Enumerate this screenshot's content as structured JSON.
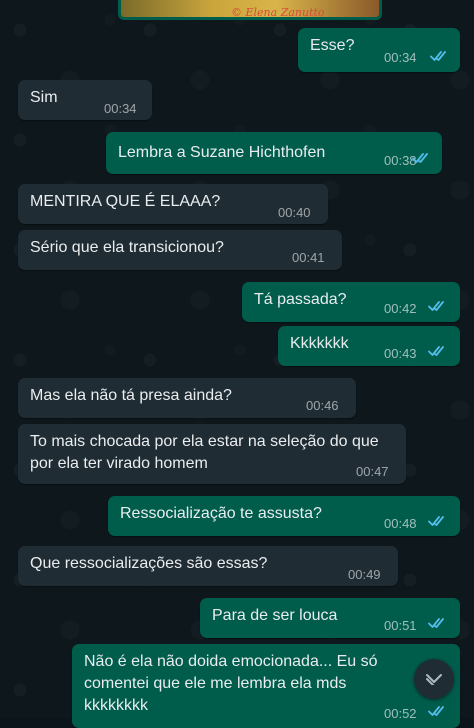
{
  "shared_image": {
    "caption": "© Elena Zanutto"
  },
  "messages": [
    {
      "dir": "out",
      "text": "Esse?",
      "time": "00:34",
      "read": true
    },
    {
      "dir": "in",
      "text": "Sim",
      "time": "00:34"
    },
    {
      "dir": "out",
      "text": "Lembra a Suzane Hichthofen",
      "time": "00:38",
      "read": true
    },
    {
      "dir": "in",
      "text": "MENTIRA QUE É ELAAA?",
      "time": "00:40"
    },
    {
      "dir": "in",
      "text": "Sério que ela transicionou?",
      "time": "00:41"
    },
    {
      "dir": "out",
      "text": "Tá passada?",
      "time": "00:42",
      "read": true
    },
    {
      "dir": "out",
      "text": "Kkkkkkk",
      "time": "00:43",
      "read": true
    },
    {
      "dir": "in",
      "text": "Mas ela não tá presa ainda?",
      "time": "00:46"
    },
    {
      "dir": "in",
      "text": "To mais chocada por ela estar na seleção do que por ela ter virado homem",
      "time": "00:47"
    },
    {
      "dir": "out",
      "text": "Ressocialização te assusta?",
      "time": "00:48",
      "read": true
    },
    {
      "dir": "in",
      "text": "Que ressocializações são essas?",
      "time": "00:49"
    },
    {
      "dir": "out",
      "text": "Para de ser louca",
      "time": "00:51",
      "read": true
    },
    {
      "dir": "out",
      "text": "Não é ela não doida emocionada... Eu só comentei que ele me lembra ela mds kkkkkkkk",
      "time": "00:52",
      "read": true
    }
  ],
  "colors": {
    "background": "#0b141a",
    "incoming_bubble": "#202c33",
    "outgoing_bubble": "#005c4b",
    "read_ticks": "#53bdeb"
  },
  "icons": {
    "scroll_down": "chevron-down-icon",
    "read_receipt": "double-check-icon"
  }
}
